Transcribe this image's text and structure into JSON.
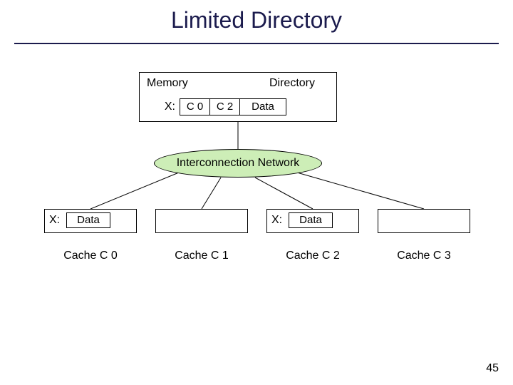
{
  "title": "Limited Directory",
  "memory": {
    "box_label": "Memory",
    "directory_label": "Directory",
    "entry": {
      "var": "X:",
      "p0": "C 0",
      "p1": "C 2",
      "data": "Data"
    }
  },
  "network": {
    "label": "Interconnection Network"
  },
  "caches": [
    {
      "name": "Cache C 0",
      "var": "X:",
      "data": "Data",
      "has_entry": true
    },
    {
      "name": "Cache C 1",
      "var": "",
      "data": "",
      "has_entry": false
    },
    {
      "name": "Cache C 2",
      "var": "X:",
      "data": "Data",
      "has_entry": true
    },
    {
      "name": "Cache C 3",
      "var": "",
      "data": "",
      "has_entry": false
    }
  ],
  "page_number": "45"
}
